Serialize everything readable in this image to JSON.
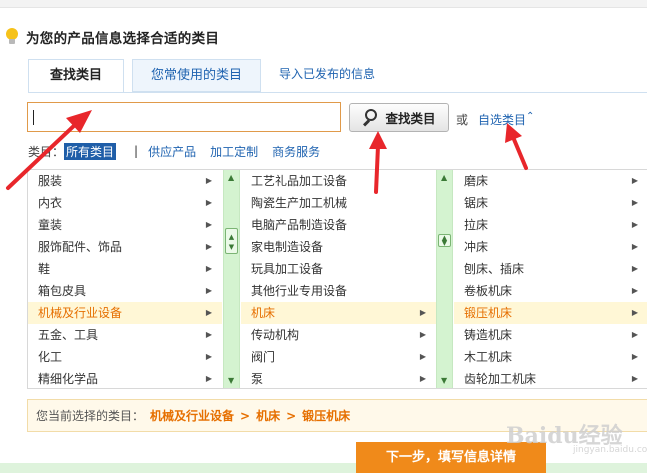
{
  "heading": "为您的产品信息选择合适的类目",
  "tabs": [
    {
      "label": "查找类目"
    },
    {
      "label": "您常使用的类目"
    },
    {
      "label": "导入已发布的信息"
    }
  ],
  "search": {
    "value": "",
    "button_label": "查找类目",
    "or_text": "或",
    "self_select_label": "自选类目",
    "self_select_icon": "chevron-up-icon"
  },
  "filter": {
    "label": "类目：",
    "items": [
      "所有类目",
      "供应产品",
      "加工定制",
      "商务服务"
    ],
    "separator": "|",
    "selected": "所有类目"
  },
  "columns": {
    "col1": [
      "服装",
      "内衣",
      "童装",
      "服饰配件、饰品",
      "鞋",
      "箱包皮具",
      "机械及行业设备",
      "五金、工具",
      "化工",
      "精细化学品"
    ],
    "col2": [
      "工艺礼品加工设备",
      "陶瓷生产加工机械",
      "电脑产品制造设备",
      "家电制造设备",
      "玩具加工设备",
      "其他行业专用设备",
      "机床",
      "传动机构",
      "阀门",
      "泵"
    ],
    "col3": [
      "磨床",
      "锯床",
      "拉床",
      "冲床",
      "刨床、插床",
      "卷板机床",
      "锻压机床",
      "铸造机床",
      "木工机床",
      "齿轮加工机床"
    ],
    "selected": {
      "col1": "机械及行业设备",
      "col2": "机床",
      "col3": "锻压机床"
    },
    "arrow_icon": "right-triangle-icon"
  },
  "selected_path": {
    "label": "您当前选择的类目：",
    "crumbs": [
      "机械及行业设备",
      "机床",
      "锻压机床"
    ],
    "separator": ">"
  },
  "next_button": "下一步，填写信息详情",
  "watermark": {
    "text": "Baidu经验",
    "sub": "jingyan.baidu.com"
  },
  "colors": {
    "accent_orange": "#e66f00",
    "link_blue": "#1f63b0",
    "annotation_red": "#e8262b",
    "scrollbar_green": "#d4f3d0",
    "next_button": "#f08a1a"
  }
}
